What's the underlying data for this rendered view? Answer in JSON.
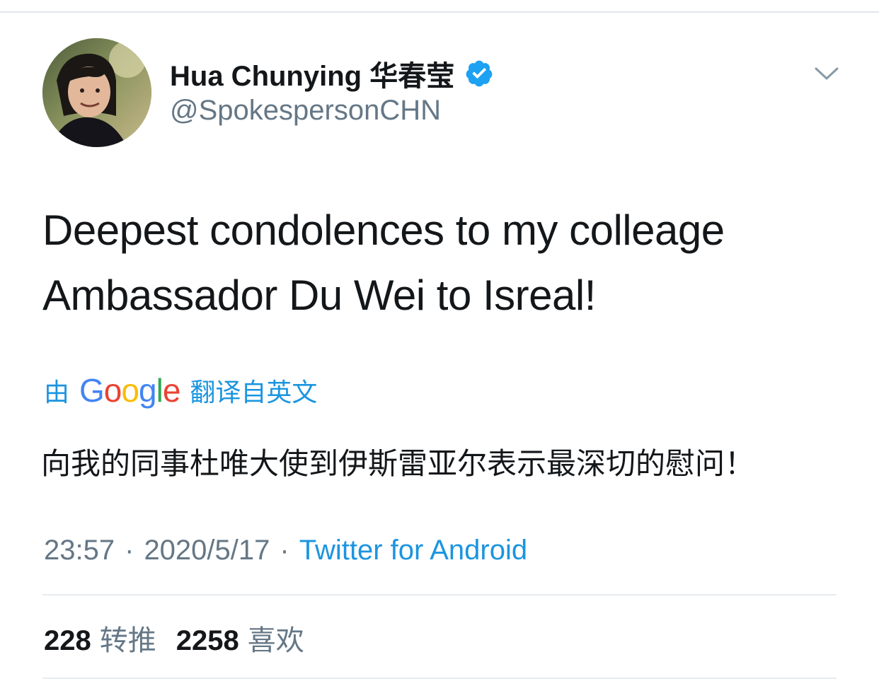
{
  "colors": {
    "text_primary": "#14171a",
    "text_secondary": "#657786",
    "link_blue": "#1b95e0",
    "verified_blue": "#1da1f2",
    "divider": "#e6ecf0"
  },
  "icons": {
    "verified": "verified-badge-icon",
    "more": "chevron-down-icon"
  },
  "author": {
    "display_name": "Hua Chunying 华春莹",
    "handle": "@SpokespersonCHN",
    "verified": true
  },
  "tweet": {
    "text_line1": "Deepest condolences to my colleage",
    "text_line2": "Ambassador Du Wei to Isreal!"
  },
  "translation": {
    "prefix": "由",
    "provider_letters": [
      "G",
      "o",
      "o",
      "g",
      "l",
      "e"
    ],
    "suffix": "翻译自英文",
    "translated_text": "向我的同事杜唯大使到伊斯雷亚尔表示最深切的慰问！"
  },
  "meta": {
    "time": "23:57",
    "separator": "·",
    "date": "2020/5/17",
    "source": "Twitter for Android"
  },
  "stats": {
    "retweets_count": "228",
    "retweets_label": "转推",
    "likes_count": "2258",
    "likes_label": "喜欢"
  }
}
